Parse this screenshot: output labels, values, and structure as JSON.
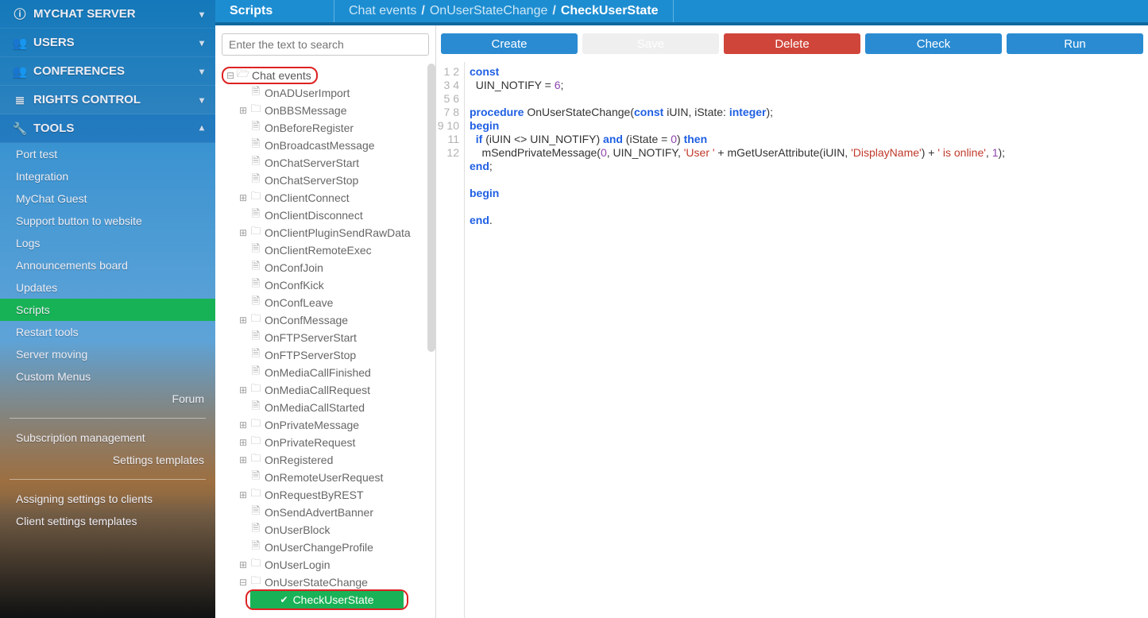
{
  "sidebar": {
    "items": [
      {
        "icon": "info-icon",
        "label": "MYCHAT SERVER",
        "expanded": false,
        "interactable": true
      },
      {
        "icon": "users-icon",
        "label": "USERS",
        "expanded": false,
        "interactable": true
      },
      {
        "icon": "users-icon",
        "label": "CONFERENCES",
        "expanded": false,
        "interactable": true
      },
      {
        "icon": "list-icon",
        "label": "RIGHTS CONTROL",
        "expanded": false,
        "interactable": true
      },
      {
        "icon": "wrench-icon",
        "label": "TOOLS",
        "expanded": true,
        "interactable": true
      }
    ],
    "tools_children": [
      "Port test",
      "Integration",
      "MyChat Guest",
      "Support button to website",
      "Logs",
      "Announcements board",
      "Updates",
      "Scripts",
      "Restart tools",
      "Server moving",
      "Custom Menus"
    ],
    "active_sub_index": 7,
    "right_links": [
      "Forum",
      "Settings templates"
    ],
    "bottom_links": [
      "Subscription management",
      "Assigning settings to clients",
      "Client settings templates"
    ]
  },
  "breadcrumb": {
    "section": "Scripts",
    "path": [
      "Chat events",
      "OnUserStateChange"
    ],
    "current": "CheckUserState"
  },
  "toolbar": {
    "create": "Create",
    "save": "Save",
    "delete": "Delete",
    "check": "Check",
    "run": "Run"
  },
  "search": {
    "placeholder": "Enter the text to search"
  },
  "tree": {
    "root": "Chat events",
    "nodes": [
      {
        "label": "OnADUserImport",
        "type": "file",
        "exp": ""
      },
      {
        "label": "OnBBSMessage",
        "type": "folder",
        "exp": "+"
      },
      {
        "label": "OnBeforeRegister",
        "type": "file",
        "exp": ""
      },
      {
        "label": "OnBroadcastMessage",
        "type": "file",
        "exp": ""
      },
      {
        "label": "OnChatServerStart",
        "type": "file",
        "exp": ""
      },
      {
        "label": "OnChatServerStop",
        "type": "file",
        "exp": ""
      },
      {
        "label": "OnClientConnect",
        "type": "folder",
        "exp": "+"
      },
      {
        "label": "OnClientDisconnect",
        "type": "file",
        "exp": ""
      },
      {
        "label": "OnClientPluginSendRawData",
        "type": "folder",
        "exp": "+"
      },
      {
        "label": "OnClientRemoteExec",
        "type": "file",
        "exp": ""
      },
      {
        "label": "OnConfJoin",
        "type": "file",
        "exp": ""
      },
      {
        "label": "OnConfKick",
        "type": "file",
        "exp": ""
      },
      {
        "label": "OnConfLeave",
        "type": "file",
        "exp": ""
      },
      {
        "label": "OnConfMessage",
        "type": "folder",
        "exp": "+"
      },
      {
        "label": "OnFTPServerStart",
        "type": "file",
        "exp": ""
      },
      {
        "label": "OnFTPServerStop",
        "type": "file",
        "exp": ""
      },
      {
        "label": "OnMediaCallFinished",
        "type": "file",
        "exp": ""
      },
      {
        "label": "OnMediaCallRequest",
        "type": "folder",
        "exp": "+"
      },
      {
        "label": "OnMediaCallStarted",
        "type": "file",
        "exp": ""
      },
      {
        "label": "OnPrivateMessage",
        "type": "folder",
        "exp": "+"
      },
      {
        "label": "OnPrivateRequest",
        "type": "folder",
        "exp": "+"
      },
      {
        "label": "OnRegistered",
        "type": "folder",
        "exp": "+"
      },
      {
        "label": "OnRemoteUserRequest",
        "type": "file",
        "exp": ""
      },
      {
        "label": "OnRequestByREST",
        "type": "folder",
        "exp": "+"
      },
      {
        "label": "OnSendAdvertBanner",
        "type": "file",
        "exp": ""
      },
      {
        "label": "OnUserBlock",
        "type": "file",
        "exp": ""
      },
      {
        "label": "OnUserChangeProfile",
        "type": "file",
        "exp": ""
      },
      {
        "label": "OnUserLogin",
        "type": "folder",
        "exp": "+"
      },
      {
        "label": "OnUserStateChange",
        "type": "folder",
        "exp": "-"
      }
    ],
    "selected": "CheckUserState"
  },
  "code": {
    "lines": [
      [
        [
          "k-blue",
          "const"
        ]
      ],
      [
        [
          "k-sym",
          "  UIN_NOTIFY = "
        ],
        [
          "k-num",
          "6"
        ],
        [
          "k-sym",
          ";"
        ]
      ],
      [],
      [
        [
          "k-blue",
          "procedure"
        ],
        [
          "k-sym",
          " OnUserStateChange("
        ],
        [
          "k-blue",
          "const"
        ],
        [
          "k-sym",
          " iUIN, iState: "
        ],
        [
          "k-blue",
          "integer"
        ],
        [
          "k-sym",
          ");"
        ]
      ],
      [
        [
          "k-blue",
          "begin"
        ]
      ],
      [
        [
          "k-sym",
          "  "
        ],
        [
          "k-blue",
          "if"
        ],
        [
          "k-sym",
          " (iUIN <> UIN_NOTIFY) "
        ],
        [
          "k-blue",
          "and"
        ],
        [
          "k-sym",
          " (iState = "
        ],
        [
          "k-num",
          "0"
        ],
        [
          "k-sym",
          ") "
        ],
        [
          "k-blue",
          "then"
        ]
      ],
      [
        [
          "k-sym",
          "    mSendPrivateMessage("
        ],
        [
          "k-num",
          "0"
        ],
        [
          "k-sym",
          ", UIN_NOTIFY, "
        ],
        [
          "k-str",
          "'User '"
        ],
        [
          "k-sym",
          " + mGetUserAttribute(iUIN, "
        ],
        [
          "k-str",
          "'DisplayName'"
        ],
        [
          "k-sym",
          ") + "
        ],
        [
          "k-str",
          "' is online'"
        ],
        [
          "k-sym",
          ", "
        ],
        [
          "k-num",
          "1"
        ],
        [
          "k-sym",
          ");"
        ]
      ],
      [
        [
          "k-blue",
          "end"
        ],
        [
          "k-sym",
          ";"
        ]
      ],
      [],
      [
        [
          "k-blue",
          "begin"
        ]
      ],
      [],
      [
        [
          "k-blue",
          "end"
        ],
        [
          "k-sym",
          "."
        ]
      ]
    ]
  }
}
